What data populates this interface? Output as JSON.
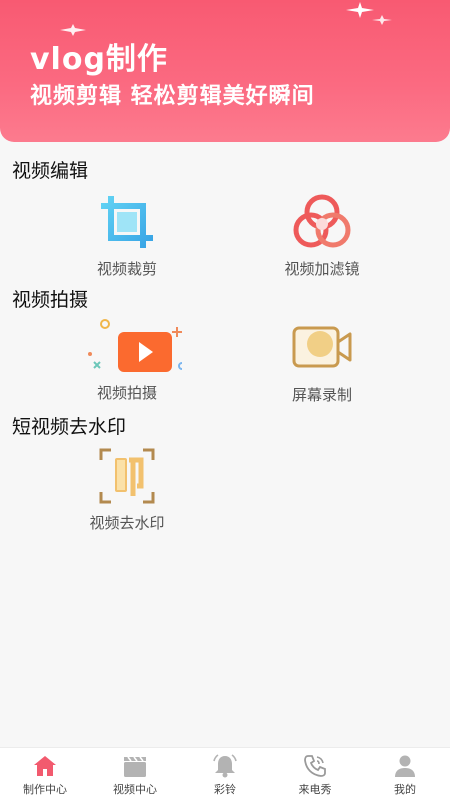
{
  "header": {
    "title": "vlog制作",
    "subtitle": "视频剪辑   轻松剪辑美好瞬间",
    "accent": "#f85a72"
  },
  "sections": [
    {
      "title": "视频编辑",
      "tools": [
        {
          "label": "视频裁剪",
          "icon": "crop-icon"
        },
        {
          "label": "视频加滤镜",
          "icon": "filter-icon"
        }
      ]
    },
    {
      "title": "视频拍摄",
      "tools": [
        {
          "label": "视频拍摄",
          "icon": "video-play-icon"
        },
        {
          "label": "屏幕录制",
          "icon": "screen-record-icon"
        }
      ]
    },
    {
      "title": "短视频去水印",
      "tools": [
        {
          "label": "视频去水印",
          "icon": "watermark-stamp-icon"
        }
      ]
    }
  ],
  "tabbar": [
    {
      "label": "制作中心",
      "icon": "home-icon",
      "active": true
    },
    {
      "label": "视频中心",
      "icon": "clapperboard-icon"
    },
    {
      "label": "彩铃",
      "icon": "bell-icon"
    },
    {
      "label": "来电秀",
      "icon": "phone-icon"
    },
    {
      "label": "我的",
      "icon": "user-icon"
    }
  ],
  "colors": {
    "tab_active": "#f25a6e",
    "tab_inactive": "#b3b3b3"
  }
}
